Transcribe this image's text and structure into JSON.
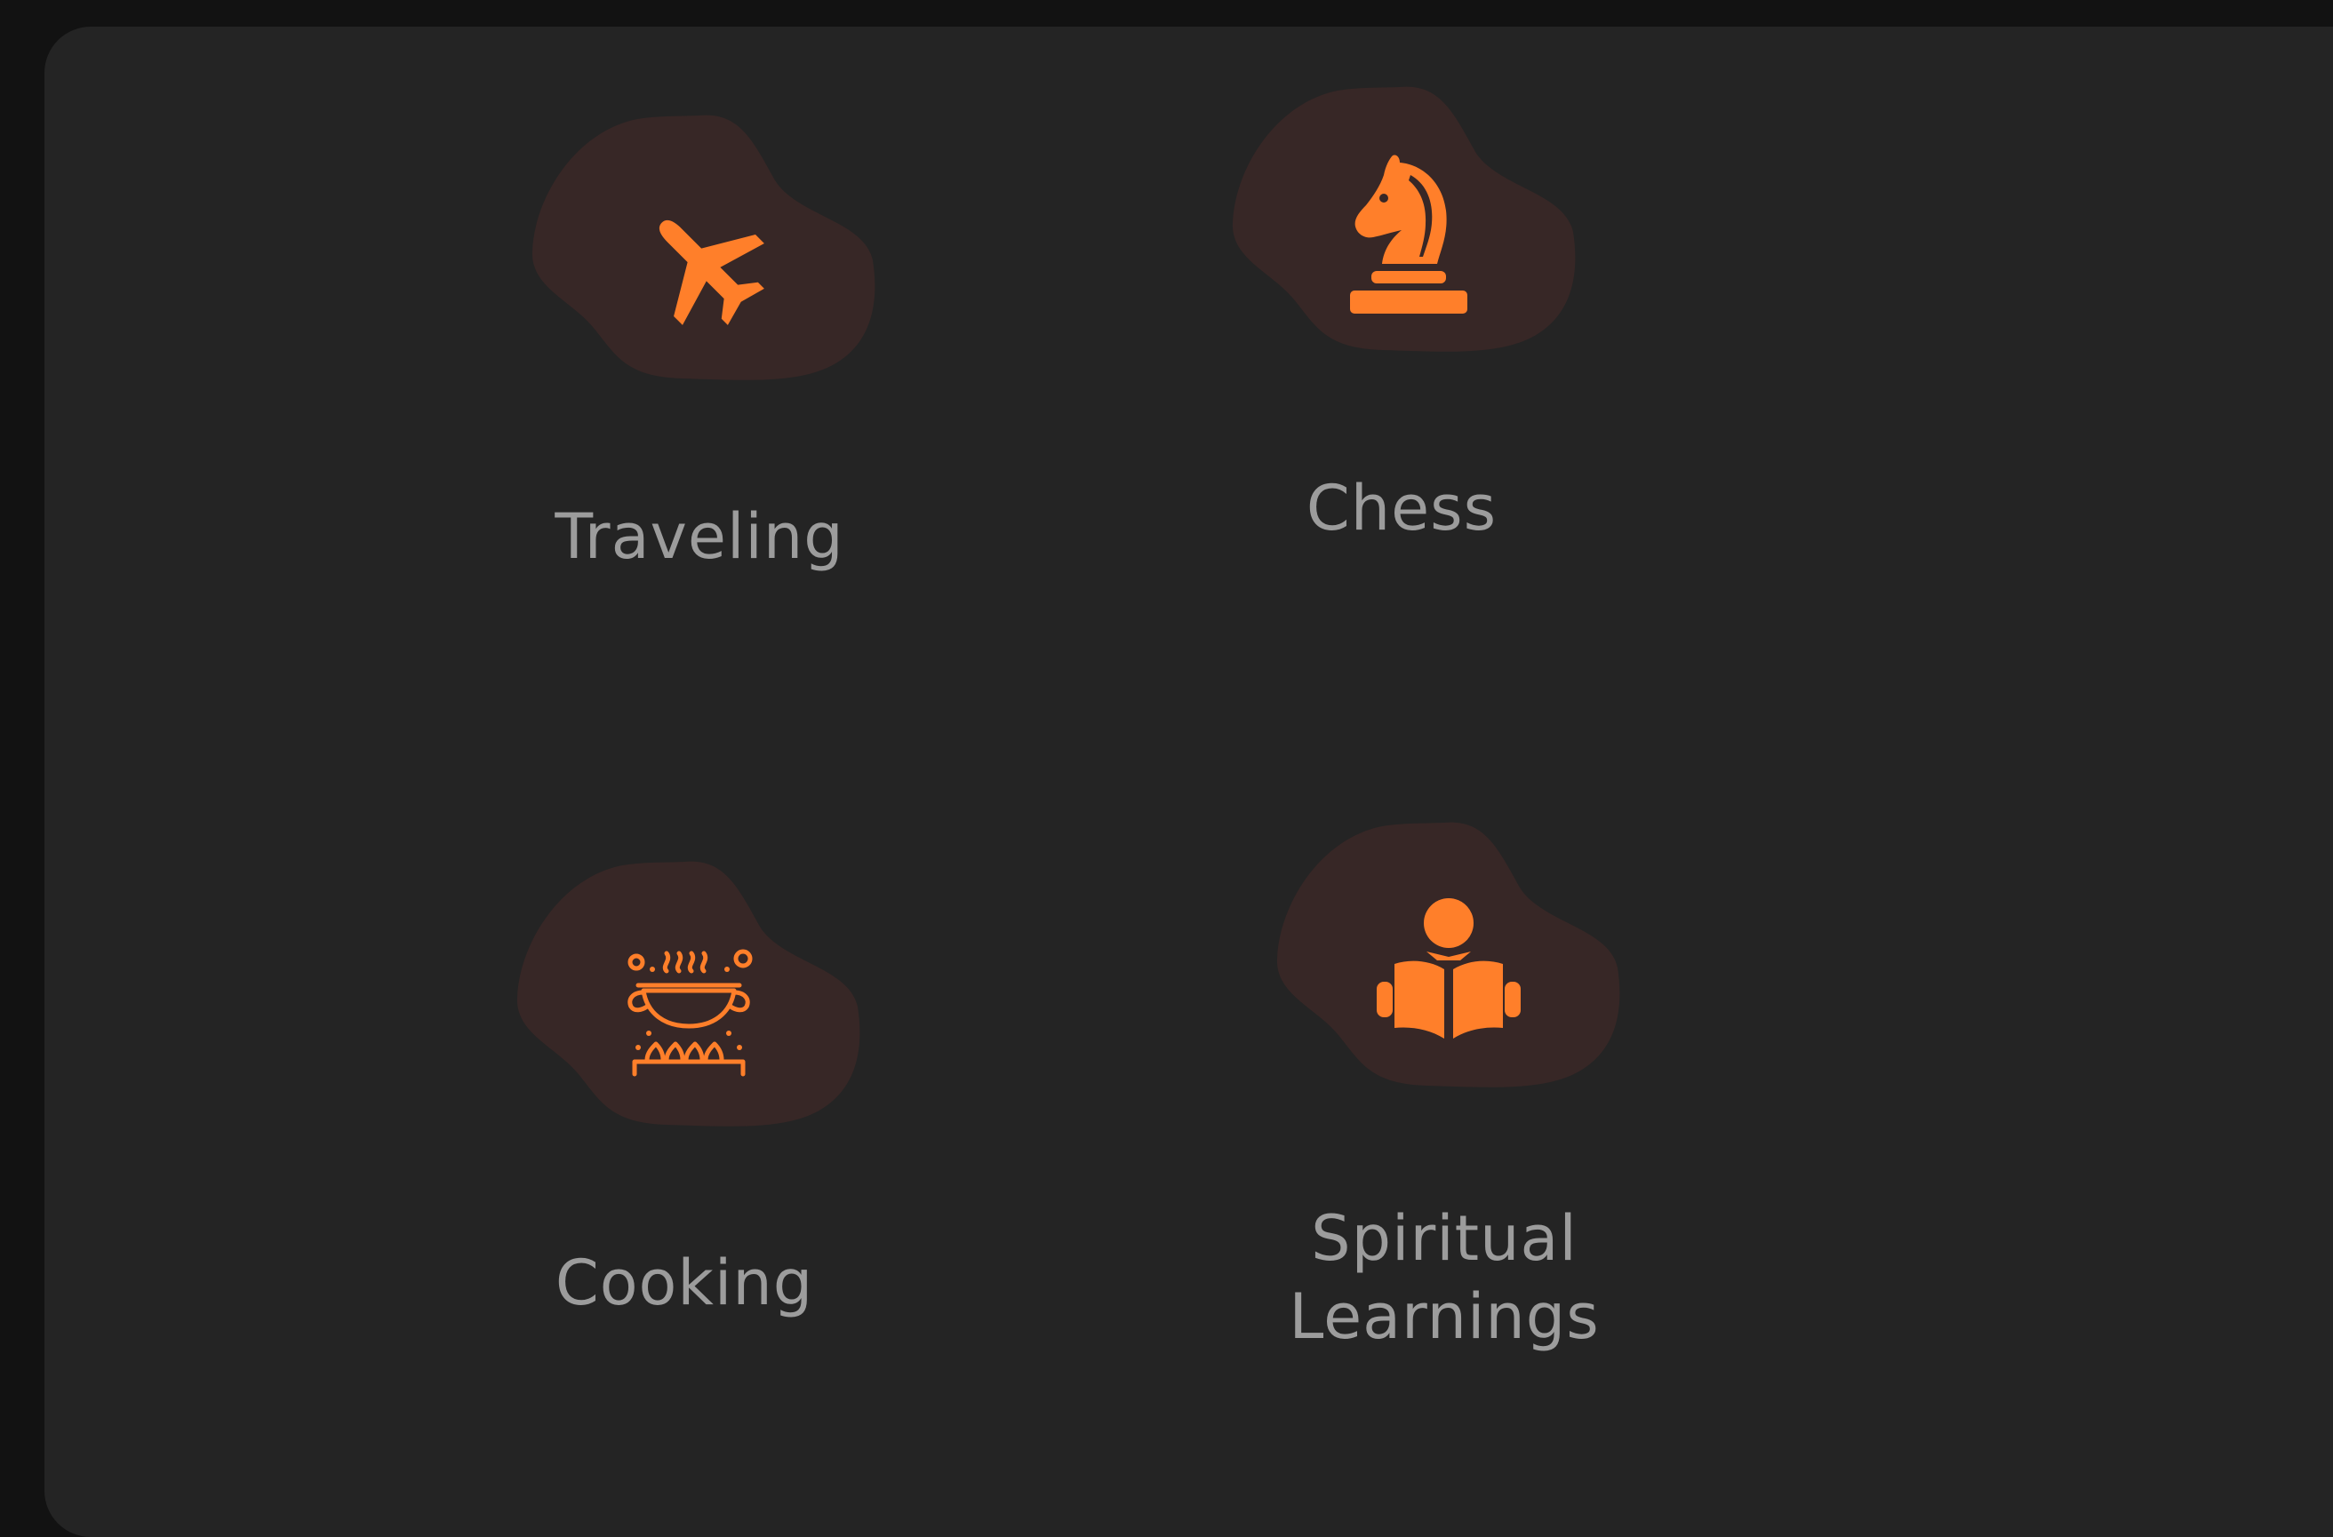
{
  "colors": {
    "page_bg": "#121212",
    "panel_bg": "#242424",
    "blob_bg": "#372726",
    "accent": "#ff7f2a",
    "label": "#9c9c9c"
  },
  "hobbies": [
    {
      "label": "Traveling",
      "icon": "airplane-icon"
    },
    {
      "label": "Chess",
      "icon": "chess-knight-icon"
    },
    {
      "label": "Cooking",
      "icon": "cooking-pot-icon"
    },
    {
      "label": "Spiritual Learnings",
      "icon": "reading-person-icon"
    }
  ]
}
